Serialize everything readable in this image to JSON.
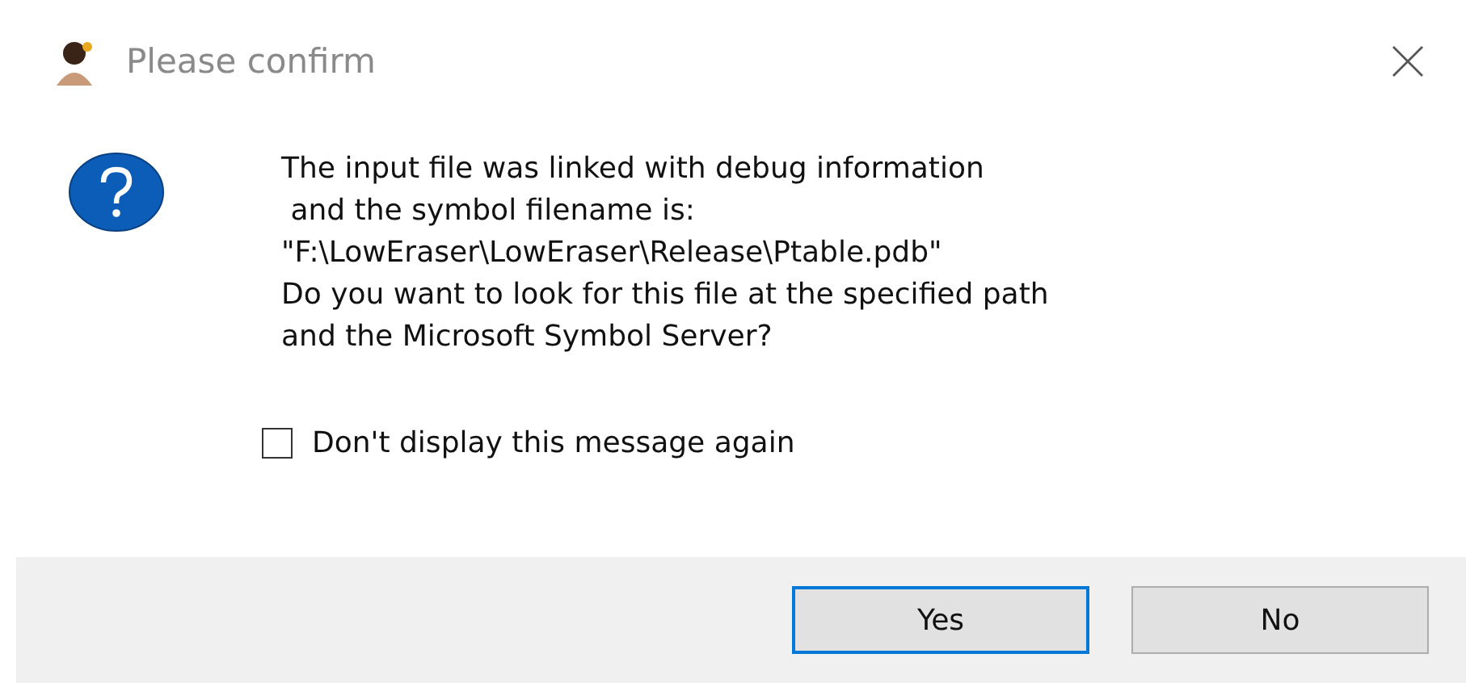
{
  "window": {
    "title": "Please confirm"
  },
  "message": "The input file was linked with debug information\n and the symbol filename is:\n\"F:\\LowEraser\\LowEraser\\Release\\Ptable.pdb\"\nDo you want to look for this file at the specified path\nand the Microsoft Symbol Server?",
  "checkbox": {
    "label": "Don't display this message again",
    "checked": false
  },
  "buttons": [
    {
      "label": "Yes",
      "default": true
    },
    {
      "label": "No",
      "default": false
    }
  ]
}
